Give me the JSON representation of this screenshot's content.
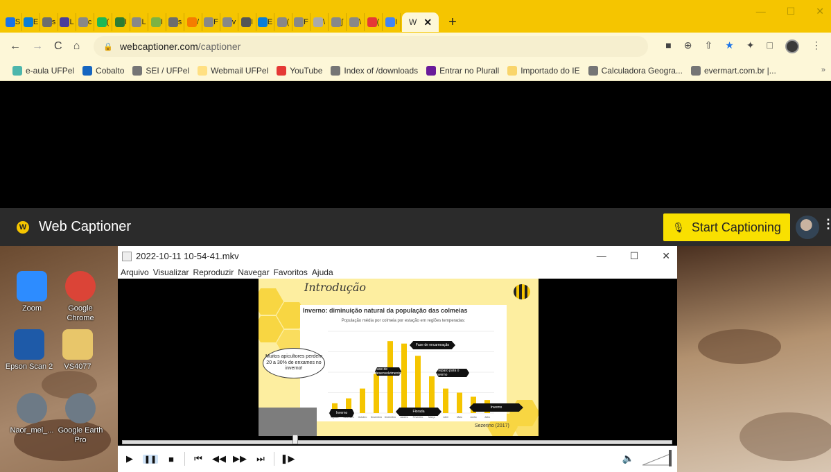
{
  "browser": {
    "tabs": [
      {
        "label": "S",
        "color": "#1a73e8"
      },
      {
        "label": "E",
        "color": "#0a7ed6"
      },
      {
        "label": "s",
        "color": "#6d6d6d"
      },
      {
        "label": "L",
        "color": "#4a3d9b"
      },
      {
        "label": "c",
        "color": "#888888"
      },
      {
        "label": "(",
        "color": "#1db954"
      },
      {
        "label": "I",
        "color": "#2e7d32"
      },
      {
        "label": "L",
        "color": "#888888"
      },
      {
        "label": "I",
        "color": "#7cb342"
      },
      {
        "label": "s",
        "color": "#6d6d6d"
      },
      {
        "label": "/",
        "color": "#f57c00"
      },
      {
        "label": "F",
        "color": "#888888"
      },
      {
        "label": "v",
        "color": "#888888"
      },
      {
        "label": "I",
        "color": "#555555"
      },
      {
        "label": "E",
        "color": "#0a7ed6"
      },
      {
        "label": "(",
        "color": "#888888"
      },
      {
        "label": "F",
        "color": "#888888"
      },
      {
        "label": "\\",
        "color": "#aaaaaa"
      },
      {
        "label": "ʃ",
        "color": "#888888"
      },
      {
        "label": "\\",
        "color": "#888888"
      },
      {
        "label": "(",
        "color": "#e53935"
      },
      {
        "label": "I",
        "color": "#4285f4"
      }
    ],
    "active_tab": {
      "label": "W",
      "close": "✕"
    },
    "new_tab": "+",
    "window_controls": {
      "minimize": "—",
      "maximize": "☐",
      "close": "✕"
    },
    "nav": {
      "back": "←",
      "forward": "→",
      "reload": "C",
      "home": "⌂"
    },
    "url": {
      "lock": "🔒",
      "domain": "webcaptioner.com",
      "path": "/captioner"
    },
    "toolbar_icons": {
      "camera": "■",
      "zoom": "⊕",
      "share": "⇧",
      "star": "★",
      "extensions": "✦",
      "sidepanel": "□",
      "menu": "⋮"
    },
    "bookmarks": [
      {
        "label": "e-aula UFPel",
        "color": "#4db6ac"
      },
      {
        "label": "Cobalto",
        "color": "#1565c0"
      },
      {
        "label": "SEI / UFPel",
        "color": "#757575"
      },
      {
        "label": "Webmail UFPel",
        "color": "#ffe082"
      },
      {
        "label": "YouTube",
        "color": "#e53935"
      },
      {
        "label": "Index of /downloads",
        "color": "#757575"
      },
      {
        "label": "Entrar no Plurall",
        "color": "#6a1b9a"
      },
      {
        "label": "Importado do IE",
        "color": "#f9d56b"
      },
      {
        "label": "Calculadora Geogra...",
        "color": "#757575"
      },
      {
        "label": "evermart.com.br |...",
        "color": "#757575"
      }
    ],
    "bookmarks_overflow": "»"
  },
  "webcaptioner": {
    "logo": "W",
    "title": "Web Captioner",
    "start_button": "Start Captioning",
    "mic": "🎙",
    "menu": "⋮"
  },
  "desktop_icons": [
    {
      "label": "Zoom",
      "color": "#2d8cff"
    },
    {
      "label": "Google Chrome",
      "color": "#db4437"
    },
    {
      "label": "Epson Scan 2",
      "color": "#1e5aa8"
    },
    {
      "label": "VS4077",
      "color": "#e8c66a"
    },
    {
      "label": "Naor_mel_...",
      "color": "#6d7a86"
    },
    {
      "label": "Google Earth Pro",
      "color": "#6d7a86"
    }
  ],
  "player": {
    "title": "2022-10-11 10-54-41.mkv",
    "window_controls": {
      "minimize": "—",
      "maximize": "☐",
      "close": "✕"
    },
    "menu": [
      "Arquivo",
      "Visualizar",
      "Reproduzir",
      "Navegar",
      "Favoritos",
      "Ajuda"
    ],
    "controls": [
      "▶",
      "❚❚",
      "■",
      "⏮",
      "◀◀",
      "▶▶",
      "⏭",
      "❚▶"
    ],
    "volume_icon": "🔈",
    "seek_progress": 0.31
  },
  "slide": {
    "title": "Introdução",
    "chart_title": "Inverno: diminuição natural da população das colmeias",
    "chart_subtitle": "População média por colmeia por estação em regiões temperadas:",
    "callout": "Muitos apicultores perdem 20 a 30% de enxames no inverno!",
    "citation": "Sezerino (2017)",
    "arrows": [
      "Inverno",
      "Fase de desenvolvimento",
      "Fase de encarneação",
      "Florada",
      "Preparo para o inverno",
      "Inverno"
    ]
  },
  "chart_data": {
    "type": "bar",
    "title": "Inverno: diminuição natural da população das colmeias",
    "subtitle": "População média por colmeia por estação em regiões temperadas:",
    "categories": [
      "Agosto",
      "Setembro",
      "Outubro",
      "Novembro",
      "Dezembro",
      "Janeiro",
      "Fevereiro",
      "Março",
      "Abril",
      "Maio",
      "Junho",
      "Julho"
    ],
    "values": [
      12,
      18,
      30,
      48,
      88,
      85,
      70,
      45,
      30,
      25,
      20,
      16
    ],
    "color": "#f5c500",
    "grid": true,
    "ylim": [
      0,
      100
    ]
  }
}
